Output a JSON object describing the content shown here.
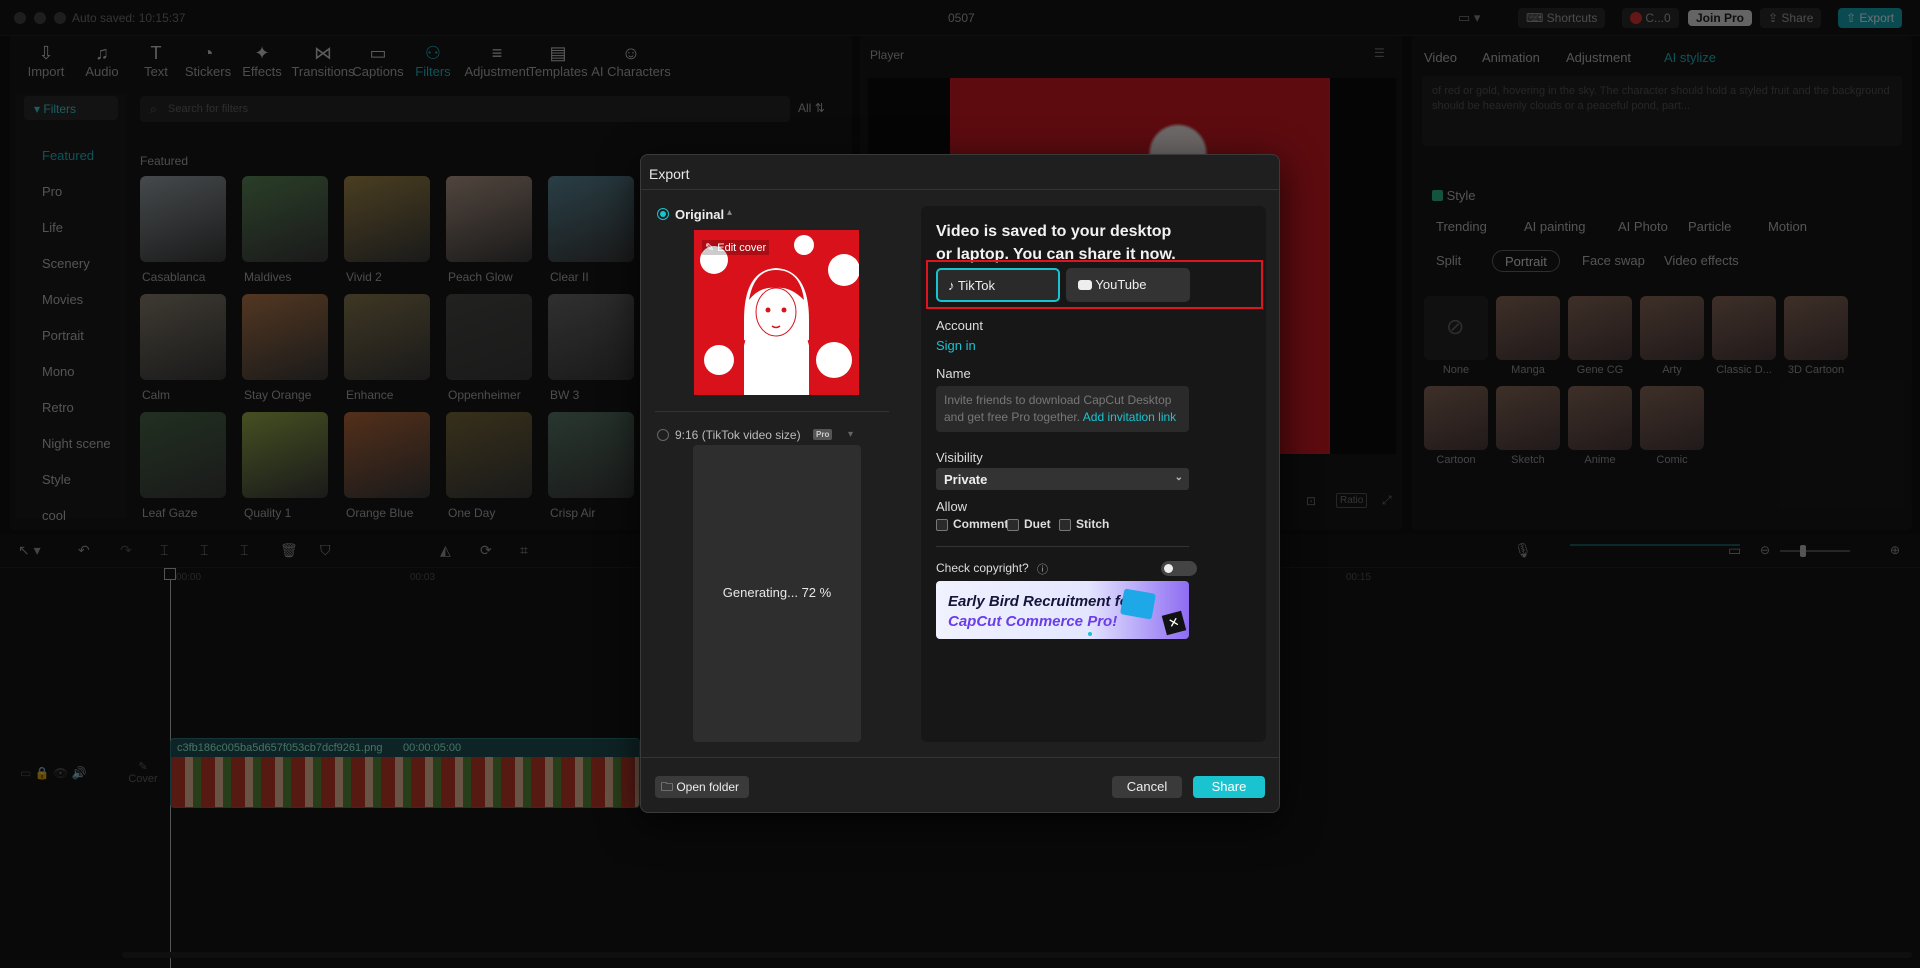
{
  "titlebar": {
    "autosave": "Auto saved: 10:15:37",
    "project": "0507",
    "shortcuts": "Shortcuts",
    "account": "C...0",
    "join_pro": "Join Pro",
    "share": "Share",
    "export": "Export"
  },
  "toolbar": {
    "items": [
      {
        "label": "Import",
        "icon": "import-icon"
      },
      {
        "label": "Audio",
        "icon": "audio-icon"
      },
      {
        "label": "Text",
        "icon": "text-icon"
      },
      {
        "label": "Stickers",
        "icon": "stickers-icon"
      },
      {
        "label": "Effects",
        "icon": "effects-icon"
      },
      {
        "label": "Transitions",
        "icon": "transitions-icon"
      },
      {
        "label": "Captions",
        "icon": "captions-icon"
      },
      {
        "label": "Filters",
        "icon": "filters-icon"
      },
      {
        "label": "Adjustment",
        "icon": "adjustment-icon"
      },
      {
        "label": "Templates",
        "icon": "templates-icon"
      },
      {
        "label": "AI Characters",
        "icon": "ai-characters-icon"
      }
    ]
  },
  "filters": {
    "header": "Filters",
    "search_placeholder": "Search for filters",
    "all_label": "All",
    "featured_label": "Featured",
    "categories": [
      "Featured",
      "Pro",
      "Life",
      "Scenery",
      "Movies",
      "Portrait",
      "Mono",
      "Retro",
      "Night scene",
      "Style",
      "cool"
    ],
    "thumbs": [
      "Casablanca",
      "Maldives",
      "Vivid 2",
      "Peach Glow",
      "Clear II",
      "Calm",
      "Stay Orange",
      "Enhance",
      "Oppenheimer",
      "BW 3",
      "Leaf Gaze",
      "Quality 1",
      "Orange Blue",
      "One Day",
      "Crisp Air"
    ]
  },
  "player": {
    "title": "Player",
    "ratio": "Ratio"
  },
  "right_panel": {
    "tabs": [
      "Video",
      "Animation",
      "Adjustment",
      "AI stylize"
    ],
    "prompt_text": "of red or gold, hovering in the sky. The character should hold a styled fruit and the background should be heavenly clouds or a peaceful pond, part...",
    "style_label": "Style",
    "style_tabs": [
      "Trending",
      "AI painting",
      "AI Photo",
      "Particle",
      "Motion",
      "Split",
      "Portrait",
      "Face swap",
      "Video effects"
    ],
    "styles": [
      "None",
      "Manga",
      "Gene CG",
      "Arty",
      "Classic D...",
      "3D Cartoon",
      "Cartoon",
      "Sketch",
      "Anime",
      "Comic"
    ]
  },
  "timeline": {
    "clip_name": "c3fb186c005ba5d657f053cb7dcf9261.png",
    "clip_duration": "00:00:05:00",
    "cover_label": "Cover",
    "ticks": [
      "00:00",
      "00:03",
      "00:06",
      "00:09",
      "00:12",
      "00:15"
    ]
  },
  "export_dialog": {
    "title": "Export",
    "option_original": "Original",
    "edit_cover": "Edit cover",
    "option_916": "9:16 (TikTok video size)",
    "pro_badge": "Pro",
    "generating": "Generating... 72 %",
    "saved_message": "Video is saved to your desktop or laptop. You can share it now.",
    "platforms": [
      "TikTok",
      "YouTube"
    ],
    "account_label": "Account",
    "sign_in": "Sign in",
    "name_label": "Name",
    "name_placeholder": "Invite friends to download CapCut Desktop and get free Pro together.",
    "invite_link": "Add invitation link",
    "visibility_label": "Visibility",
    "visibility_value": "Private",
    "allow_label": "Allow",
    "allow_options": [
      "Comment",
      "Duet",
      "Stitch"
    ],
    "copyright_label": "Check copyright?",
    "banner_line1": "Early Bird Recruitment for",
    "banner_line2": "CapCut Commerce Pro!",
    "open_folder": "Open folder",
    "cancel": "Cancel",
    "share": "Share"
  },
  "colors": {
    "accent": "#19c3d0",
    "highlight_box": "#e0141e",
    "cover_red": "#d8111a"
  }
}
